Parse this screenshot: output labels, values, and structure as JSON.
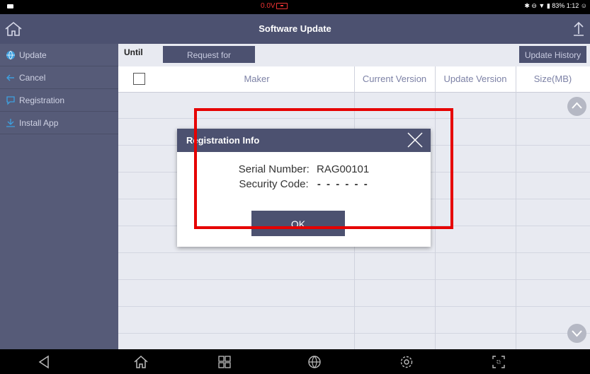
{
  "status_bar": {
    "voltage": "0.0V",
    "right_status": "✱ ⊖ ▼ ▮ 83% 1:12 ☺"
  },
  "title_bar": {
    "title": "Software Update"
  },
  "sidebar": {
    "items": [
      {
        "label": "Update",
        "icon": "globe-icon"
      },
      {
        "label": "Cancel",
        "icon": "arrow-left-icon"
      },
      {
        "label": "Registration",
        "icon": "chat-icon"
      },
      {
        "label": "Install App",
        "icon": "download-icon"
      }
    ]
  },
  "toolbar": {
    "until_label": "Until",
    "extension_button": "Request for Extension",
    "history_button": "Update History"
  },
  "table": {
    "headers": [
      "Maker",
      "Current Version",
      "Update Version",
      "Size(MB)"
    ]
  },
  "dialog": {
    "title": "Registration Info",
    "serial_label": "Serial Number:",
    "serial_value": "RAG00101",
    "security_label": "Security Code:",
    "security_value": "- - - - - -",
    "ok_button": "OK"
  },
  "colors": {
    "accent": "#4c5170",
    "sidebar": "#565b78",
    "annotation": "#e60000",
    "header_text": "#7d82a6"
  }
}
